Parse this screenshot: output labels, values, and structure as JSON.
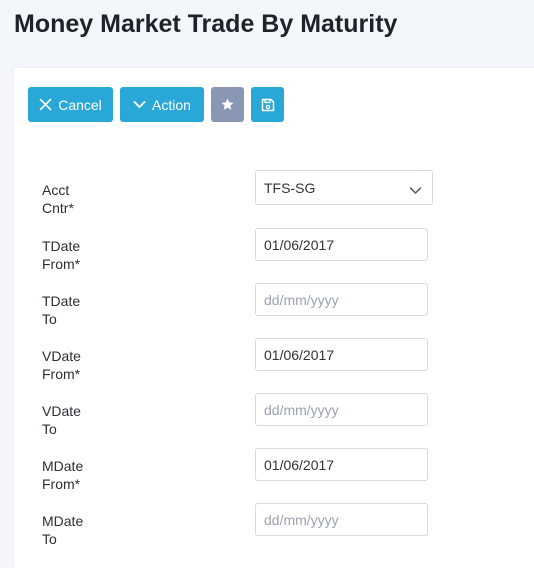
{
  "page": {
    "title": "Money Market Trade By Maturity"
  },
  "toolbar": {
    "cancel_label": "Cancel",
    "action_label": "Action",
    "favorite_icon": "star-icon",
    "save_icon": "save-icon"
  },
  "colors": {
    "primary": "#29a8d8",
    "secondary": "#8997b5",
    "background": "#f3f6fa"
  },
  "form": {
    "acct_cntr": {
      "label": "Acct Cntr*",
      "value": "TFS-SG"
    },
    "tdate_from": {
      "label": "TDate From*",
      "value": "01/06/2017",
      "placeholder": "dd/mm/yyyy"
    },
    "tdate_to": {
      "label": "TDate To",
      "value": "",
      "placeholder": "dd/mm/yyyy"
    },
    "vdate_from": {
      "label": "VDate From*",
      "value": "01/06/2017",
      "placeholder": "dd/mm/yyyy"
    },
    "vdate_to": {
      "label": "VDate To",
      "value": "",
      "placeholder": "dd/mm/yyyy"
    },
    "mdate_from": {
      "label": "MDate From*",
      "value": "01/06/2017",
      "placeholder": "dd/mm/yyyy"
    },
    "mdate_to": {
      "label": "MDate To",
      "value": "",
      "placeholder": "dd/mm/yyyy"
    }
  }
}
